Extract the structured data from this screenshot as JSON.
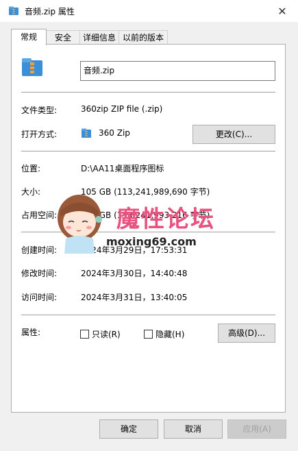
{
  "window": {
    "title": "音频.zip 属性",
    "close_icon": "close-icon"
  },
  "tabs": [
    {
      "label": "常规",
      "active": true
    },
    {
      "label": "安全",
      "active": false
    },
    {
      "label": "详细信息",
      "active": false
    },
    {
      "label": "以前的版本",
      "active": false
    }
  ],
  "general": {
    "file_name": "音频.zip",
    "file_type_label": "文件类型:",
    "file_type_value": "360zip ZIP file (.zip)",
    "open_with_label": "打开方式:",
    "open_with_value": "360 Zip",
    "change_button": "更改(C)...",
    "location_label": "位置:",
    "location_value": "D:\\AA11桌面程序图标",
    "size_label": "大小:",
    "size_value": "105 GB (113,241,989,690 字节)",
    "size_on_disk_label": "占用空间:",
    "size_on_disk_value": "105 GB (113,241,993,216 字节)",
    "created_label": "创建时间:",
    "created_value": "2024年3月29日，17:53:31",
    "modified_label": "修改时间:",
    "modified_value": "2024年3月30日，14:40:48",
    "accessed_label": "访问时间:",
    "accessed_value": "2024年3月31日，13:40:05",
    "attributes_label": "属性:",
    "readonly_label": "只读(R)",
    "readonly_checked": false,
    "hidden_label": "隐藏(H)",
    "hidden_checked": false,
    "advanced_button": "高级(D)..."
  },
  "footer": {
    "ok": "确定",
    "cancel": "取消",
    "apply": "应用(A)"
  },
  "watermark": {
    "title": "魔性论坛",
    "url": "moxing69.com"
  },
  "colors": {
    "accent_pink": "#e8527e",
    "archive_blue": "#3a8fd8",
    "archive_orange": "#f2a03a"
  }
}
